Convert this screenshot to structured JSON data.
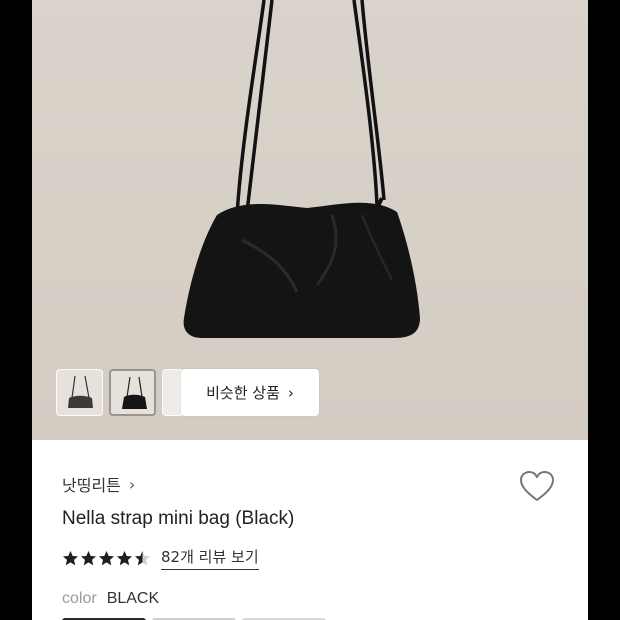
{
  "gallery": {
    "similar_products_label": "비슷한 상품",
    "thumbnails": [
      {
        "name": "thumbnail-1",
        "selected": false
      },
      {
        "name": "thumbnail-2",
        "selected": true
      },
      {
        "name": "thumbnail-3",
        "selected": false
      }
    ]
  },
  "product": {
    "brand": "낫띵리튼",
    "title": "Nella strap mini bag (Black)",
    "rating": 4.5,
    "stars_total": 5,
    "review_link": "82개 리뷰 보기",
    "color_label": "color",
    "color_value": "BLACK"
  },
  "icons": {
    "brand_chevron": "chevron-right-icon",
    "similar_chevron": "chevron-right-icon",
    "wishlist": "heart-outline-icon",
    "star": "star-icon"
  },
  "colors": {
    "star": "#1f1f1f",
    "bag": "#141414",
    "hero_bg": "#d7d0c7",
    "swatch_dark": "#2a2a2a",
    "swatch_light": "#cfcfcf"
  }
}
